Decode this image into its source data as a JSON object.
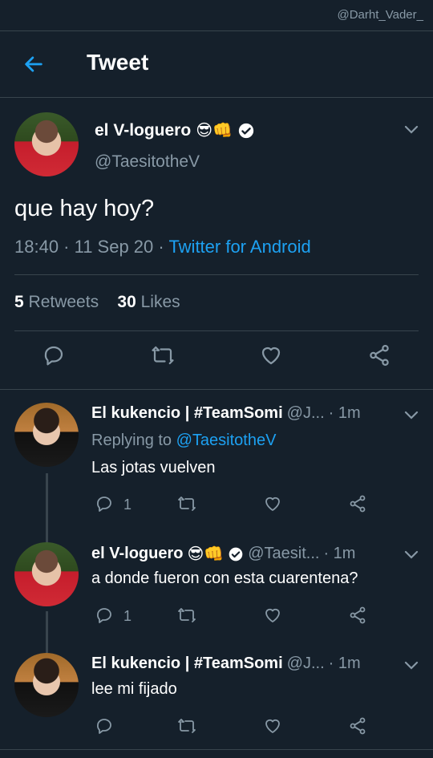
{
  "watermark": "@Darht_Vader_",
  "header": {
    "title": "Tweet"
  },
  "tweet": {
    "name": "el V-loguero",
    "emojis": "😎👊",
    "handle": "@TaesitotheV",
    "text": "que hay hoy?",
    "time_date": "18:40 · 11 Sep 20 · ",
    "client": "Twitter for Android",
    "retweets_count": "5",
    "retweets_label": "Retweets",
    "likes_count": "30",
    "likes_label": "Likes"
  },
  "replies": [
    {
      "name": "El kukencio | #TeamSomi",
      "handle": "@J...",
      "time": "· 1m",
      "replying_prefix": "Replying to ",
      "replying_to": "@TaesitotheV",
      "text": "Las jotas vuelven",
      "reply_count": "1"
    },
    {
      "name": "el V-loguero",
      "emojis": "😎👊",
      "handle": "@Taesit...",
      "time": "· 1m",
      "text": "a donde fueron con esta cuarentena?",
      "reply_count": "1"
    },
    {
      "name": "El kukencio | #TeamSomi",
      "handle": "@J...",
      "time": "· 1m",
      "text": "lee mi fijado",
      "reply_count": ""
    }
  ],
  "colors": {
    "background": "#15202b",
    "accent": "#1da1f2",
    "muted": "#8899a6",
    "divider": "#38444d"
  },
  "icons": [
    "back-arrow-icon",
    "chevron-down-icon",
    "verified-badge-icon",
    "reply-icon",
    "retweet-icon",
    "like-icon",
    "share-icon"
  ]
}
